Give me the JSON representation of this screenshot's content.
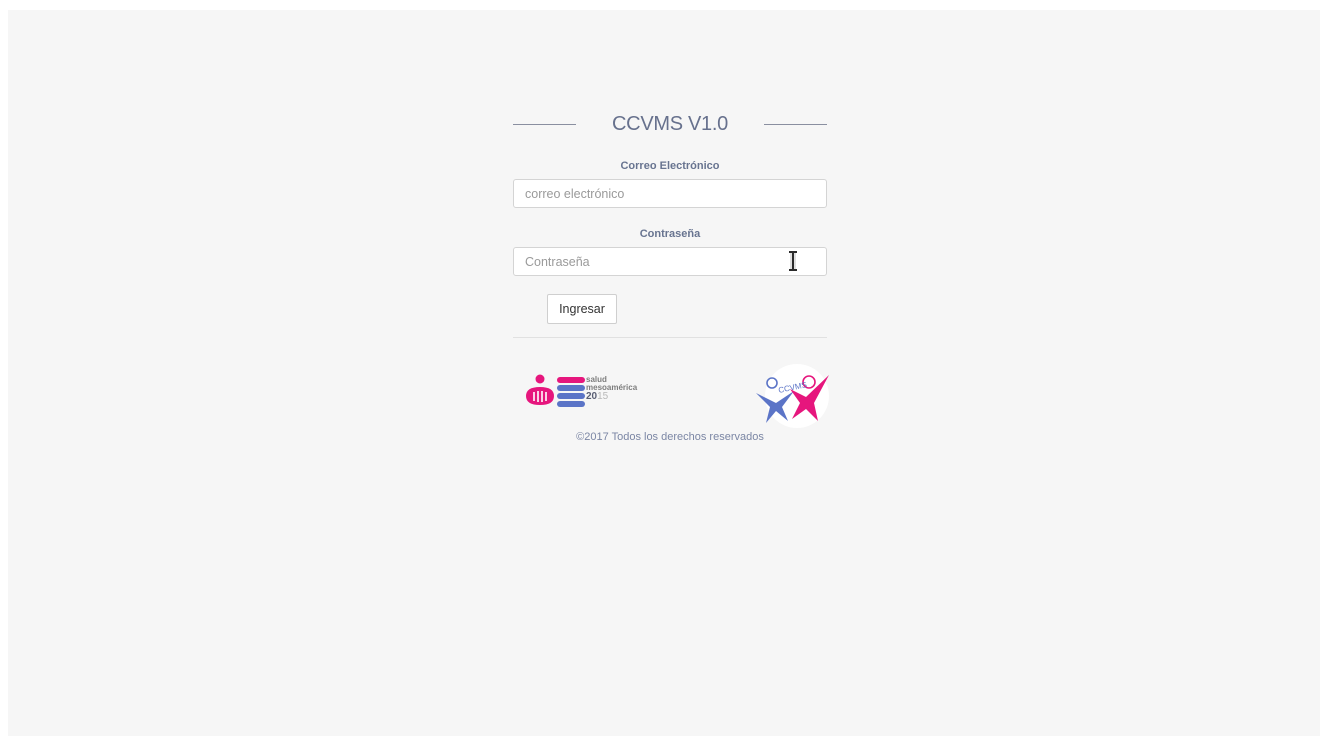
{
  "app": {
    "title": "CCVMS V1.0"
  },
  "form": {
    "email": {
      "label": "Correo Electrónico",
      "placeholder": "correo electrónico",
      "value": ""
    },
    "password": {
      "label": "Contraseña",
      "placeholder": "Contraseña",
      "value": ""
    },
    "submit_label": "Ingresar"
  },
  "logos": {
    "left": {
      "name": "salud-mesoamerica-logo",
      "text_line1": "salud",
      "text_line2": "mesoamérica",
      "year_bold": "20",
      "year_light": "15"
    },
    "right": {
      "name": "ccvms-logo",
      "text": "CCVMS"
    }
  },
  "footer": {
    "copyright": "©2017 Todos los derechos reservados"
  },
  "colors": {
    "background": "#f6f6f6",
    "title": "#67718d",
    "label": "#687490",
    "brand_pink": "#e6167d",
    "brand_blue": "#5b74c7"
  },
  "icons": {
    "text_cursor": "text-cursor-icon"
  }
}
